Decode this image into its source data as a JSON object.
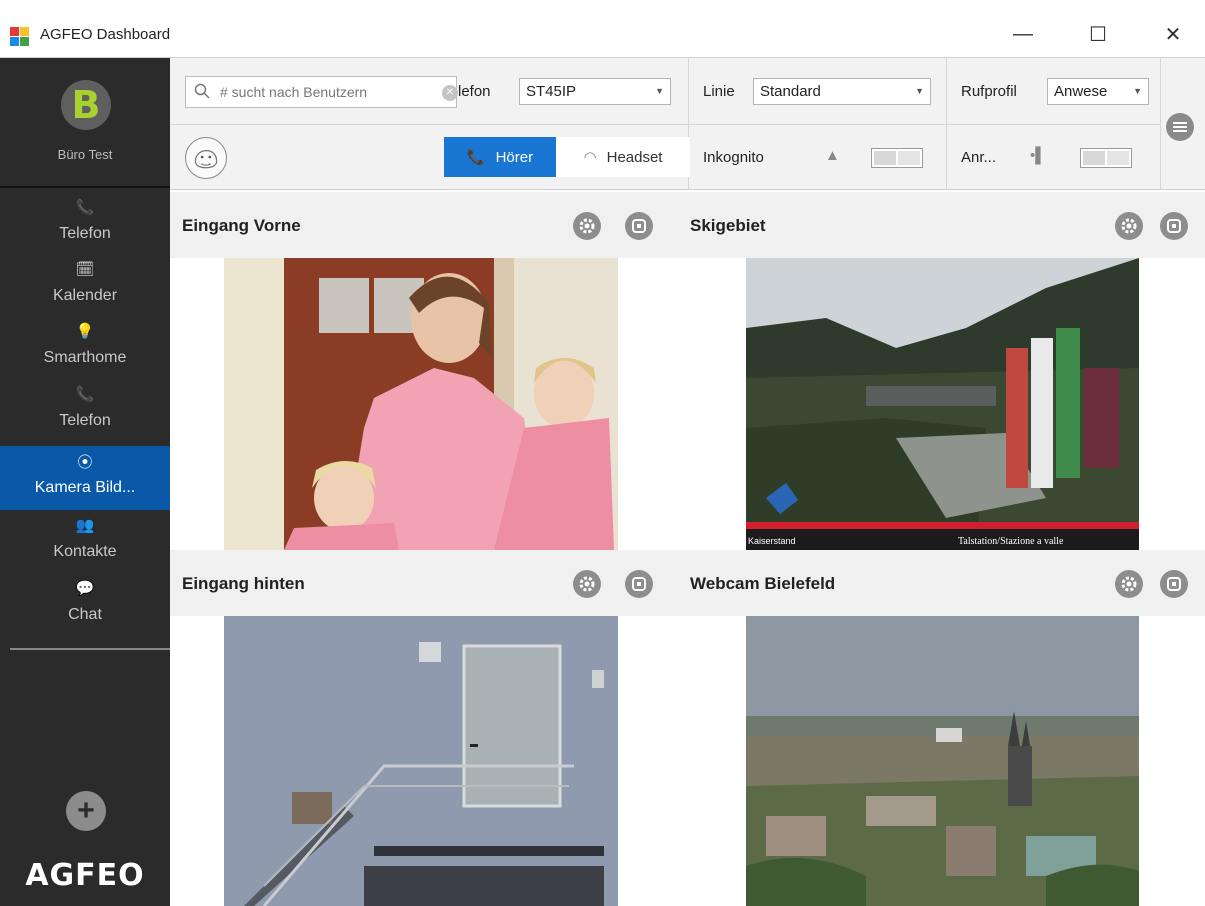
{
  "window": {
    "title": "AGFEO Dashboard",
    "minimize": "—",
    "maximize": "☐",
    "close": "✕"
  },
  "sidebar": {
    "profile_initial": "B",
    "profile_name": "Büro Test",
    "items": [
      {
        "label": "Telefon",
        "icon": "phone-icon",
        "glyph": "📞"
      },
      {
        "label": "Kalender",
        "icon": "calendar-icon",
        "glyph": "🗓"
      },
      {
        "label": "Smarthome",
        "icon": "lightbulb-icon",
        "glyph": "💡"
      },
      {
        "label": "Telefon",
        "icon": "phone-icon",
        "glyph": "📞"
      },
      {
        "label": "Kamera Bild...",
        "icon": "camera-icon",
        "glyph": "⦿",
        "active": true
      },
      {
        "label": "Kontakte",
        "icon": "contacts-icon",
        "glyph": "👥"
      },
      {
        "label": "Chat",
        "icon": "chat-icon",
        "glyph": "💬"
      }
    ],
    "add_glyph": "+",
    "logo": "AGFEO"
  },
  "toolbar": {
    "search_placeholder": "# sucht nach Benutzern",
    "telefon_label": "lefon",
    "telefon_value": "ST45IP",
    "linie_label": "Linie",
    "linie_value": "Standard",
    "rufprofil_label": "Rufprofil",
    "rufprofil_value": "Anwese",
    "hoerer_label": "Hörer",
    "headset_label": "Headset",
    "inkognito_label": "Inkognito",
    "anr_label": "Anr..."
  },
  "cameras": [
    {
      "title": "Eingang Vorne"
    },
    {
      "title": "Skigebiet",
      "overlay_left": "Kaiserstand",
      "overlay_right": "Talstation/Stazione a valle"
    },
    {
      "title": "Eingang hinten"
    },
    {
      "title": "Webcam Bielefeld"
    }
  ],
  "colors": {
    "accent": "#1976d2",
    "sidebar_bg": "#2b2b2b",
    "active_nav": "#0a59a8",
    "brand_green": "#a8d22e"
  }
}
